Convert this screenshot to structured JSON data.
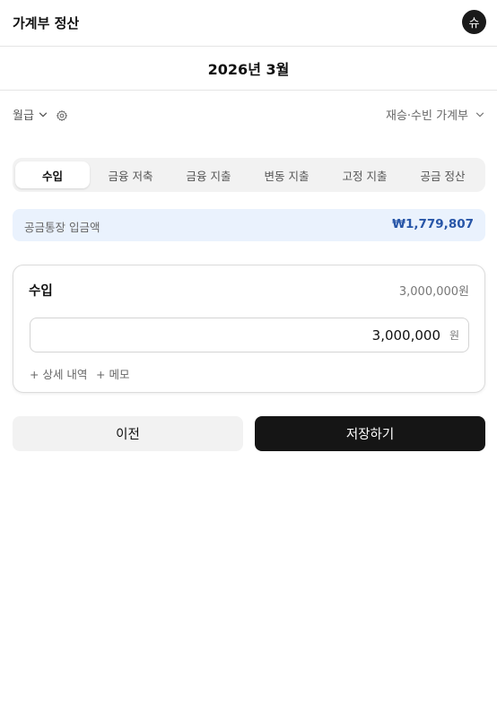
{
  "app": {
    "title": "가계부 정산",
    "avatar_initial": "슈"
  },
  "period": {
    "title": "2026년 3월"
  },
  "filters": {
    "pay_type": "월급",
    "ledger": "재승·수빈 가계부"
  },
  "tabs": [
    {
      "label": "수입",
      "active": true
    },
    {
      "label": "금융 저축",
      "active": false
    },
    {
      "label": "금융 지출",
      "active": false
    },
    {
      "label": "변동 지출",
      "active": false
    },
    {
      "label": "고정 지출",
      "active": false
    },
    {
      "label": "공금 정산",
      "active": false
    }
  ],
  "deposit": {
    "label": "공금통장 입금액",
    "amount": "₩1,779,807"
  },
  "income_card": {
    "title": "수입",
    "total": "3,000,000원",
    "input_value": "3,000,000",
    "unit": "원",
    "detail_link": "+ 상세 내역",
    "memo_link": "+ 메모"
  },
  "actions": {
    "prev_label": "이전",
    "save_label": "저장하기"
  },
  "colors": {
    "accent": "#2856a8",
    "deposit_bg": "#eaf2fd",
    "primary_button": "#151515"
  }
}
